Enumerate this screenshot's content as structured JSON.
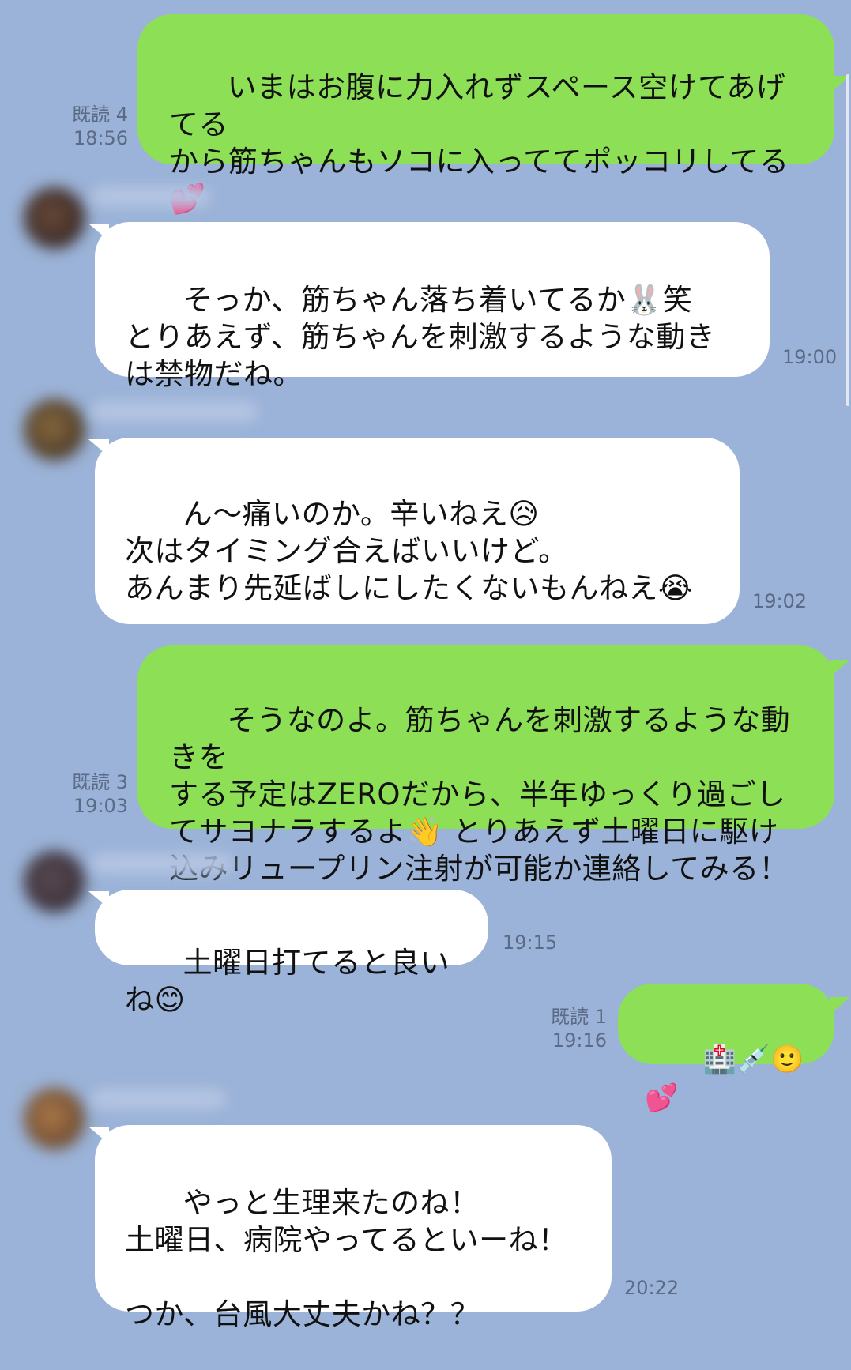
{
  "conversation": {
    "messages": [
      {
        "direction": "out",
        "text": "いまはお腹に力入れずスペース空けてあげてる\nから筋ちゃんもソコに入っててポッコリしてる\n💕",
        "read": "既読 4",
        "time": "18:56"
      },
      {
        "direction": "in",
        "text": "そっか、筋ちゃん落ち着いてるか🐰笑\nとりあえず、筋ちゃんを刺激するような動き\nは禁物だね。",
        "time": "19:00"
      },
      {
        "direction": "in",
        "text": "ん〜痛いのか。辛いねえ😥\n次はタイミング合えばいいけど。\nあんまり先延ばしにしたくないもんねえ😭",
        "time": "19:02"
      },
      {
        "direction": "out",
        "text": "そうなのよ。筋ちゃんを刺激するような動きを\nする予定はZEROだから、半年ゆっくり過ごし\nてサヨナラするよ👋 とりあえず土曜日に駆け\n込みリュープリン注射が可能か連絡してみる！",
        "read": "既読 3",
        "time": "19:03"
      },
      {
        "direction": "in",
        "text": "土曜日打てると良いね😊",
        "time": "19:15"
      },
      {
        "direction": "out",
        "text": "🏥💉🙂💕",
        "read": "既読 1",
        "time": "19:16"
      },
      {
        "direction": "in",
        "text": "やっと生理来たのね！\n土曜日、病院やってるといーね！\n\nつか、台風大丈夫かね？？",
        "time": "20:22"
      }
    ]
  },
  "icons": {
    "avatar": "contact-avatar-blurred",
    "rabbit_emoji": "rabbit-face-icon",
    "sad_emoji": "sad-face-icon",
    "crying_emoji": "crying-face-icon",
    "wave_emoji": "waving-hand-icon",
    "smile_emoji": "smiling-face-icon",
    "hospital_emoji": "hospital-icon",
    "syringe_emoji": "syringe-icon",
    "heart_emoji": "two-hearts-icon"
  },
  "colors": {
    "background": "#9bb3d8",
    "outgoing_bubble": "#8de055",
    "incoming_bubble": "#ffffff",
    "meta_text": "#5b6a86"
  }
}
